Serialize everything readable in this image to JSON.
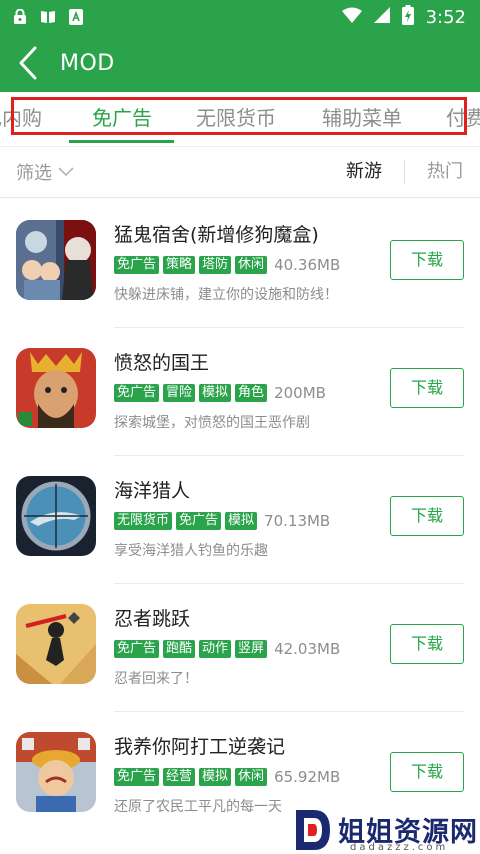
{
  "status_bar": {
    "time": "3:52",
    "left_icons": [
      "lock-icon",
      "book-icon",
      "notification-a-icon"
    ],
    "right_icons": [
      "wifi-icon",
      "signal-icon",
      "battery-charging-icon"
    ]
  },
  "header": {
    "title": "MOD",
    "back_icon": "back-chevron-icon"
  },
  "tabs": [
    {
      "label": "免内购",
      "visible_text": "色内购",
      "active": false
    },
    {
      "label": "免广告",
      "active": true
    },
    {
      "label": "无限货币",
      "active": false
    },
    {
      "label": "辅助菜单",
      "active": false
    },
    {
      "label": "付费",
      "visible_text": "付费",
      "active": false
    }
  ],
  "filter": {
    "label": "筛选",
    "icon": "chevron-down-icon",
    "sort_options": [
      "新游",
      "热门"
    ],
    "sort_selected": "新游"
  },
  "apps": [
    {
      "name": "猛鬼宿舍(新增修狗魔盒)",
      "tags": [
        "免广告",
        "策略",
        "塔防",
        "休闲"
      ],
      "size": "40.36MB",
      "description": "快躲进床铺，建立你的设施和防线！",
      "button": "下载"
    },
    {
      "name": "愤怒的国王",
      "tags": [
        "免广告",
        "冒险",
        "模拟",
        "角色"
      ],
      "size": "200MB",
      "description": "探索城堡，对愤怒的国王恶作剧",
      "button": "下载"
    },
    {
      "name": "海洋猎人",
      "tags": [
        "无限货币",
        "免广告",
        "模拟"
      ],
      "size": "70.13MB",
      "description": "享受海洋猎人钓鱼的乐趣",
      "button": "下载"
    },
    {
      "name": "忍者跳跃",
      "tags": [
        "免广告",
        "跑酷",
        "动作",
        "竖屏"
      ],
      "size": "42.03MB",
      "description": "忍者回来了！",
      "button": "下载"
    },
    {
      "name": "我养你阿打工逆袭记",
      "tags": [
        "免广告",
        "经营",
        "模拟",
        "休闲"
      ],
      "size": "65.92MB",
      "description": "还原了农民工平凡的每一天",
      "button": "下载"
    }
  ],
  "watermark": {
    "text": "姐姐资源网",
    "url": "dadazzz.com"
  },
  "colors": {
    "brand_green": "#2aa34a",
    "highlight_red": "#e0201e",
    "text_dark": "#222222",
    "text_gray": "#8d8d8d"
  }
}
